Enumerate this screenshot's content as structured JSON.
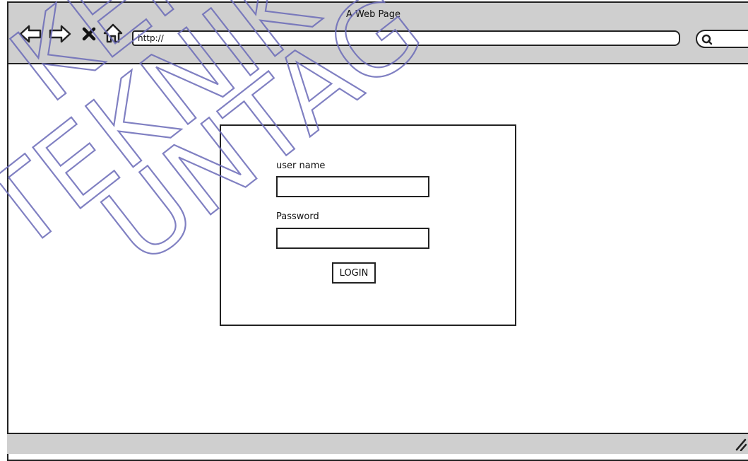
{
  "browser": {
    "title": "A Web Page",
    "url": "http://"
  },
  "login": {
    "username_label": "user name",
    "username_value": "",
    "password_label": "Password",
    "password_value": "",
    "button_label": "LOGIN"
  },
  "watermark": {
    "line1": "KERTAS",
    "line2": "TEKNIK",
    "line3": "UNTAG",
    "color": "#6b6bb8"
  },
  "colors": {
    "chrome": "#cfcfcf",
    "ink": "#222222",
    "background": "#ffffff"
  },
  "icons": [
    "back-arrow-icon",
    "forward-arrow-icon",
    "close-icon",
    "home-icon",
    "search-icon",
    "resize-grip-icon"
  ]
}
